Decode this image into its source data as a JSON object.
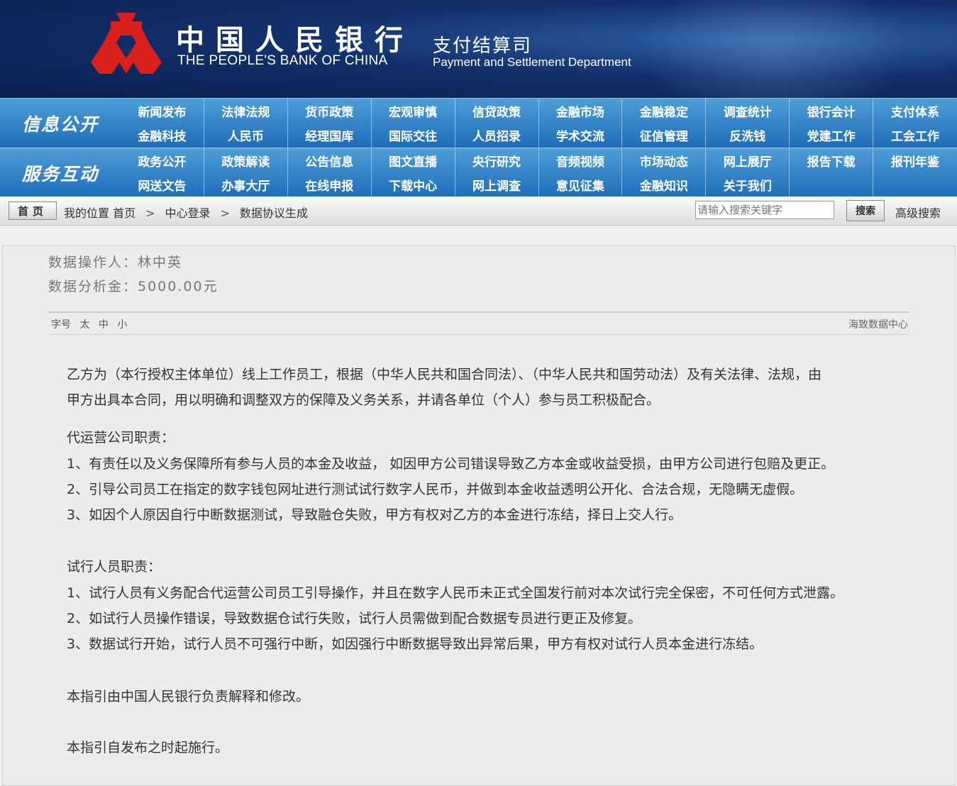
{
  "header": {
    "cn_name": "中国人民银行",
    "en_name": "THE PEOPLE'S BANK OF CHINA",
    "dept_cn": "支付结算司",
    "dept_en": "Payment and Settlement Department"
  },
  "nav": {
    "section1": "信息公开",
    "section2": "服务互动",
    "items1": [
      "新闻发布",
      "法律法规",
      "货币政策",
      "宏观审慎",
      "信贷政策",
      "金融市场",
      "金融稳定",
      "调查统计",
      "银行会计",
      "支付体系",
      "金融科技",
      "人民币",
      "经理国库",
      "国际交往",
      "人员招录",
      "学术交流",
      "征信管理",
      "反洗钱",
      "党建工作",
      "工会工作"
    ],
    "items2": [
      "政务公开",
      "政策解读",
      "公告信息",
      "图文直播",
      "央行研究",
      "音频视频",
      "市场动态",
      "网上展厅",
      "报告下载",
      "报刊年鉴",
      "网送文告",
      "办事大厅",
      "在线申报",
      "下载中心",
      "网上调查",
      "意见征集",
      "金融知识",
      "关于我们",
      "",
      ""
    ]
  },
  "location": {
    "home": "首页",
    "prefix": "我的位置 首页",
    "sep": ">",
    "crumb1": "中心登录",
    "crumb2": "数据协议生成",
    "search_placeholder": "请输入搜索关键字",
    "search_button": "搜索",
    "advanced": "高级搜索"
  },
  "content": {
    "operator": "数据操作人：林中英",
    "fee": "数据分析金：5000.00元",
    "font_label": "字号",
    "font_large": "太",
    "font_medium": "中",
    "font_small": "小",
    "source": "海致数据中心",
    "para1_line1": "乙方为（本行授权主体单位）线上工作员工，根据（中华人民共和国合同法）、（中华人民共和国劳动法）及有关法律、法规，由",
    "para1_line2": "甲方出具本合同，用以明确和调整双方的保障及义务关系，并请各单位（个人）参与员工积极配合。",
    "section1_title": "代运营公司职责：",
    "section1_items": [
      "1、有责任以及义务保障所有参与人员的本金及收益，  如因甲方公司错误导致乙方本金或收益受损，由甲方公司进行包赔及更正。",
      "2、引导公司员工在指定的数字钱包网址进行测试试行数字人民币，并做到本金收益透明公开化、合法合规，无隐瞒无虚假。",
      "3、如因个人原因自行中断数据测试，导致融仓失败，甲方有权对乙方的本金进行冻结，择日上交人行。"
    ],
    "section2_title": "试行人员职责：",
    "section2_items": [
      "1、试行人员有义务配合代运营公司员工引导操作，并且在数字人民币未正式全国发行前对本次试行完全保密，不可任何方式泄露。",
      "2、如试行人员操作错误，导致数据仓试行失败，试行人员需做到配合数据专员进行更正及修复。",
      "3、数据试行开始，试行人员不可强行中断，如因强行中断数据导致出异常后果，甲方有权对试行人员本金进行冻结。"
    ],
    "note1": "本指引由中国人民银行负责解释和修改。",
    "note2": "本指引自发布之时起施行。"
  },
  "colors": {
    "header_bg": "#12306b",
    "nav_bg": "#2f80c6",
    "logo_red": "#d9201c",
    "page_bg": "#efefef"
  }
}
